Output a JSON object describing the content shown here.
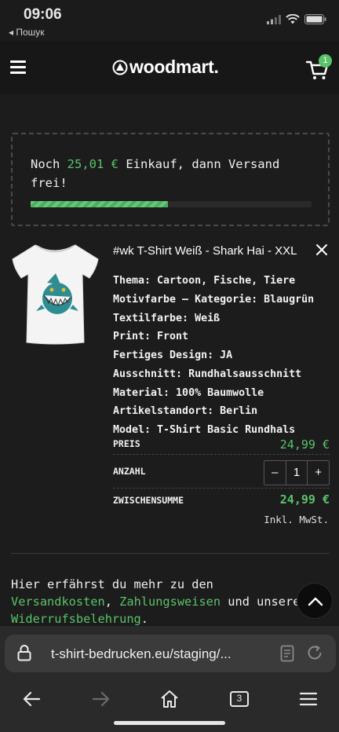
{
  "status_bar": {
    "time": "09:06",
    "back_label": "◂ Пошук"
  },
  "header": {
    "logo": "woodmart.",
    "cart_count": "1"
  },
  "shipping_notice": {
    "prefix": "Noch ",
    "amount": "25,01 €",
    "suffix": " Einkauf, dann Versand frei!",
    "progress_fraction": 0.49
  },
  "product": {
    "title": "#wk T-Shirt Weiß - Shark Hai - XXL",
    "attributes": [
      "Thema: Cartoon, Fische, Tiere",
      "Motivfarbe – Kategorie: Blaugrün",
      "Textilfarbe: Weiß",
      "Print: Front",
      "Fertiges Design: JA",
      "Ausschnitt: Rundhalsausschnitt",
      "Material: 100% Baumwolle",
      "Artikelstandort: Berlin",
      "Model: T-Shirt Basic Rundhals"
    ],
    "price_label": "PREIS",
    "price": "24,99 €",
    "quantity_label": "ANZAHL",
    "quantity": "1",
    "minus": "–",
    "plus": "+",
    "subtotal_label": "ZWISCHENSUMME",
    "subtotal": "24,99 €",
    "vat_note": "Inkl. MwSt."
  },
  "info": {
    "text_1": "Hier erfährst du mehr zu den ",
    "link_shipping": "Versandkosten",
    "sep": ", ",
    "link_payment": "Zahlungsweisen",
    "text_2": " und unsere ",
    "link_withdrawal": "Widerrufsbelehrung",
    "end": "."
  },
  "browser": {
    "url": "t-shirt-bedrucken.eu/staging/...",
    "tab_count": "3"
  },
  "colors": {
    "accent": "#59c36a",
    "background": "#1c1c1c",
    "header": "#171717"
  }
}
